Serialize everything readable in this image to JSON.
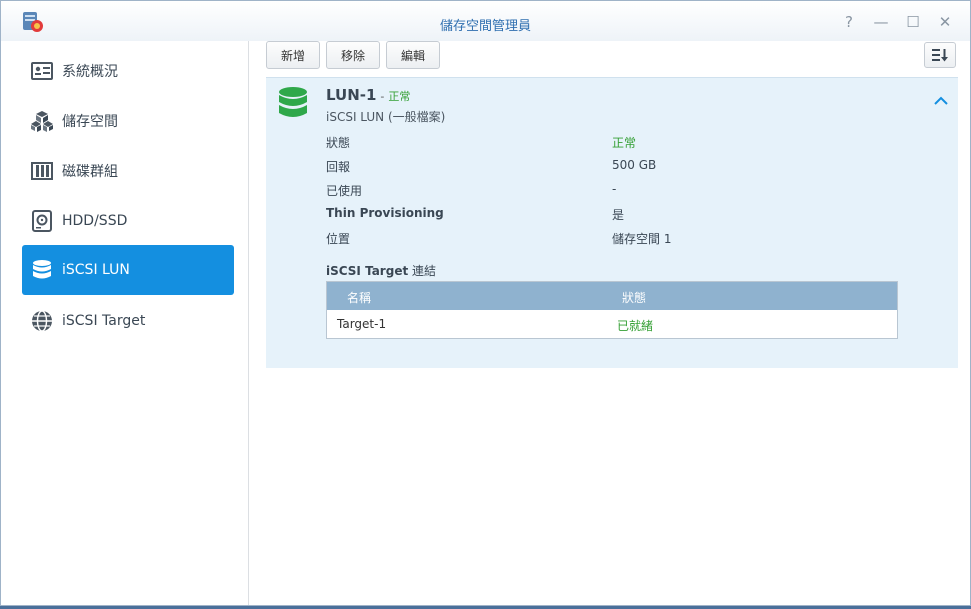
{
  "window": {
    "title": "儲存空間管理員",
    "controls": {
      "help": "?",
      "minimize": "—",
      "maximize": "☐",
      "close": "✕"
    }
  },
  "sidebar": {
    "items": [
      {
        "label": "系統概況",
        "icon": "overview-icon"
      },
      {
        "label": "儲存空間",
        "icon": "cubes-icon"
      },
      {
        "label": "磁碟群組",
        "icon": "disk-group-icon"
      },
      {
        "label": "HDD/SSD",
        "icon": "hdd-icon"
      },
      {
        "label": "iSCSI LUN",
        "icon": "database-icon",
        "active": true
      },
      {
        "label": "iSCSI Target",
        "icon": "globe-icon"
      }
    ]
  },
  "toolbar": {
    "add_label": "新增",
    "remove_label": "移除",
    "edit_label": "編輯"
  },
  "lun": {
    "name": "LUN-1",
    "dash": "-",
    "status": "正常",
    "type": "iSCSI LUN (一般檔案)",
    "properties": [
      {
        "label": "狀態",
        "value": "正常"
      },
      {
        "label": "回報",
        "value": "500 GB"
      },
      {
        "label": "已使用",
        "value": "-"
      },
      {
        "label": "Thin Provisioning",
        "value": "是"
      },
      {
        "label": "位置",
        "value": "儲存空間 1"
      }
    ]
  },
  "target_section": {
    "title_bold": "iSCSI Target",
    "title_rest": " 連結",
    "columns": [
      "名稱",
      "狀態"
    ],
    "rows": [
      {
        "name": "Target-1",
        "status": "已就緒"
      }
    ]
  },
  "colors": {
    "accent": "#148fe0",
    "status_ok": "#35a035",
    "panel_bg": "#e6f2fa",
    "table_head": "#8fb2cf"
  }
}
